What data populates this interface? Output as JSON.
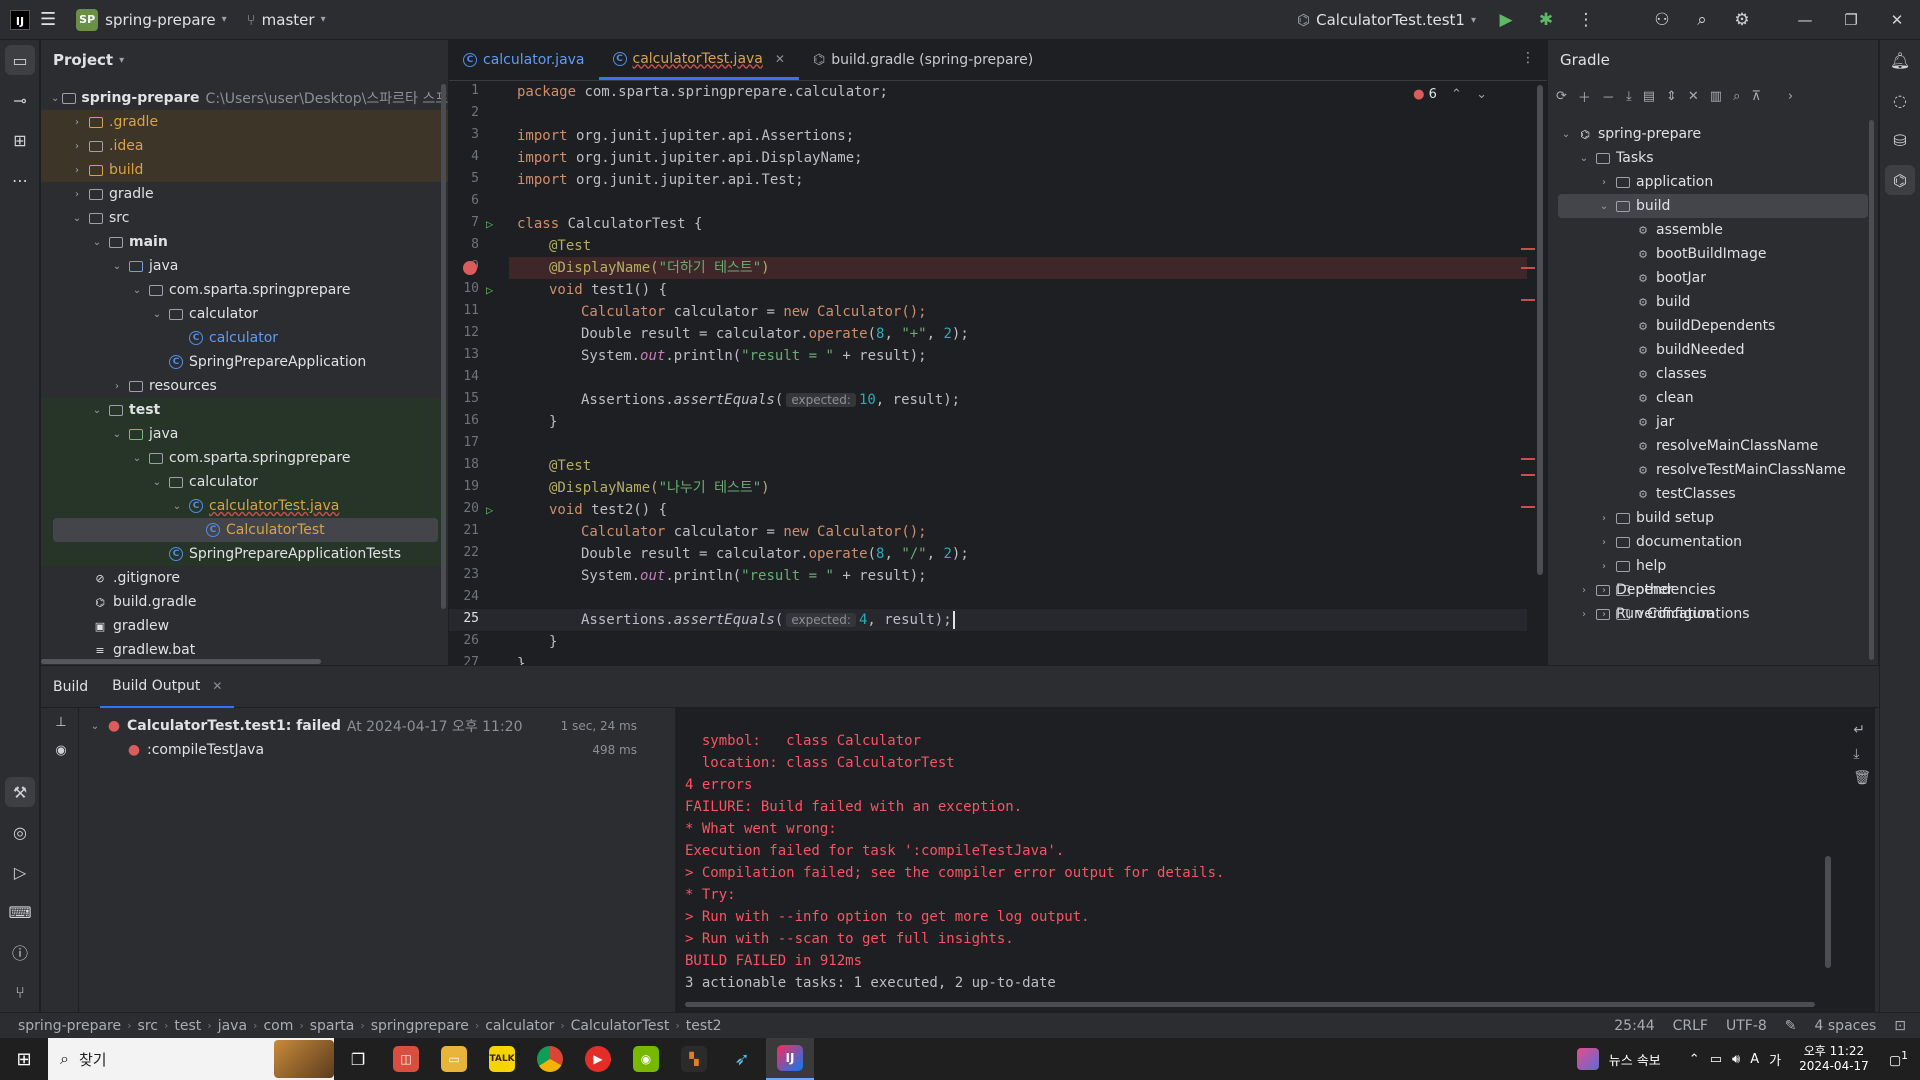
{
  "titlebar": {
    "project_badge": "SP",
    "project_name": "spring-prepare",
    "branch": "master",
    "run_config": "CalculatorTest.test1"
  },
  "project_panel": {
    "title": "Project",
    "root_name": "spring-prepare",
    "root_path": "C:\\Users\\user\\Desktop\\스파르타 스프링\\",
    "items": [
      {
        "label": ".gradle"
      },
      {
        "label": ".idea"
      },
      {
        "label": "build"
      },
      {
        "label": "gradle"
      },
      {
        "label": "src"
      },
      {
        "label": "main"
      },
      {
        "label": "java"
      },
      {
        "label": "com.sparta.springprepare"
      },
      {
        "label": "calculator"
      },
      {
        "label": "calculator"
      },
      {
        "label": "SpringPrepareApplication"
      },
      {
        "label": "resources"
      },
      {
        "label": "test"
      },
      {
        "label": "java"
      },
      {
        "label": "com.sparta.springprepare"
      },
      {
        "label": "calculator"
      },
      {
        "label": "calculatorTest.java"
      },
      {
        "label": "CalculatorTest"
      },
      {
        "label": "SpringPrepareApplicationTests"
      },
      {
        "label": ".gitignore"
      },
      {
        "label": "build.gradle"
      },
      {
        "label": "gradlew"
      },
      {
        "label": "gradlew.bat"
      }
    ]
  },
  "editor": {
    "tabs": [
      {
        "label": "calculator.java"
      },
      {
        "label": "calculatorTest.java"
      },
      {
        "label": "build.gradle (spring-prepare)"
      }
    ],
    "error_count": "6",
    "line_numbers": [
      "1",
      "2",
      "3",
      "4",
      "5",
      "6",
      "7",
      "8",
      "9",
      "10",
      "11",
      "12",
      "13",
      "14",
      "15",
      "16",
      "17",
      "18",
      "19",
      "20",
      "21",
      "22",
      "23",
      "24",
      "25",
      "26",
      "27"
    ],
    "code": {
      "l1_kw": "package",
      "l1_rest": " com.sparta.springprepare.calculator;",
      "import_kw": "import",
      "l3_rest": " org.junit.jupiter.api.Assertions;",
      "l4_rest": " org.junit.jupiter.api.DisplayName;",
      "l5_rest": " org.junit.jupiter.api.Test;",
      "l7_kw": "class",
      "l7_rest": " CalculatorTest {",
      "test_ann": "@Test",
      "l9_ann": "@DisplayName(",
      "l9_str": "\"더하기 테스트\"",
      "l9_end": ")",
      "void_kw": "void",
      "l10_rest": " test1() {",
      "calc_type": "Calculator",
      "calc_var": " calculator = ",
      "new_kw": "new",
      "calc_ctor": " Calculator();",
      "dbl_decl": "Double result = calculator.",
      "operate": "operate",
      "open": "(",
      "n8": "8",
      "comma": ", ",
      "plus_str": "\"+\"",
      "n2": "2",
      "close": ");",
      "sys": "System.",
      "out": "out",
      "println": ".println(",
      "result_str": "\"result = \"",
      "plus_result": " + result);",
      "assert_cls": "Assertions.",
      "assert_m": "assertEquals",
      "hint_expected": "expected:",
      "n10": "10",
      "result_end": ", result);",
      "brace": "}",
      "l19_str": "\"나누기 테스트\"",
      "l20_rest": " test2() {",
      "div_str": "\"/\"",
      "n4": "4"
    }
  },
  "gradle_panel": {
    "title": "Gradle",
    "root": "spring-prepare",
    "tasks_label": "Tasks",
    "groups": [
      {
        "label": "application"
      },
      {
        "label": "build"
      }
    ],
    "build_tasks": [
      "assemble",
      "bootBuildImage",
      "bootJar",
      "build",
      "buildDependents",
      "buildNeeded",
      "classes",
      "clean",
      "jar",
      "resolveMainClassName",
      "resolveTestMainClassName",
      "testClasses"
    ],
    "other_groups": [
      "build setup",
      "documentation",
      "help",
      "other",
      "verification"
    ],
    "dependencies": "Dependencies",
    "run_configs": "Run Configurations"
  },
  "build_window": {
    "tab_build": "Build",
    "tab_output": "Build Output",
    "result_title": "CalculatorTest.test1: failed",
    "result_time": "At 2024-04-17 오후 11:20",
    "result_duration": "1 sec, 24 ms",
    "sub_task": ":compileTestJava",
    "sub_duration": "498 ms",
    "caret": "^",
    "console": [
      "  symbol:   class Calculator",
      "  location: class CalculatorTest",
      "4 errors",
      "FAILURE: Build failed with an exception.",
      "* What went wrong:",
      "Execution failed for task ':compileTestJava'.",
      "> Compilation failed; see the compiler error output for details.",
      "* Try:",
      "> Run with --info option to get more log output.",
      "> Run with --scan to get full insights.",
      "BUILD FAILED in 912ms"
    ],
    "console_last": "3 actionable tasks: 1 executed, 2 up-to-date"
  },
  "statusbar": {
    "crumbs": [
      "spring-prepare",
      "src",
      "test",
      "java",
      "com",
      "sparta",
      "springprepare",
      "calculator",
      "CalculatorTest",
      "test2"
    ],
    "position": "25:44",
    "line_sep": "CRLF",
    "encoding": "UTF-8",
    "indent": "4 spaces"
  },
  "taskbar": {
    "search_placeholder": "찾기",
    "news": "뉴스 속보",
    "time": "오후 11:22",
    "date": "2024-04-17",
    "ime": "A",
    "notif_count": "1"
  }
}
